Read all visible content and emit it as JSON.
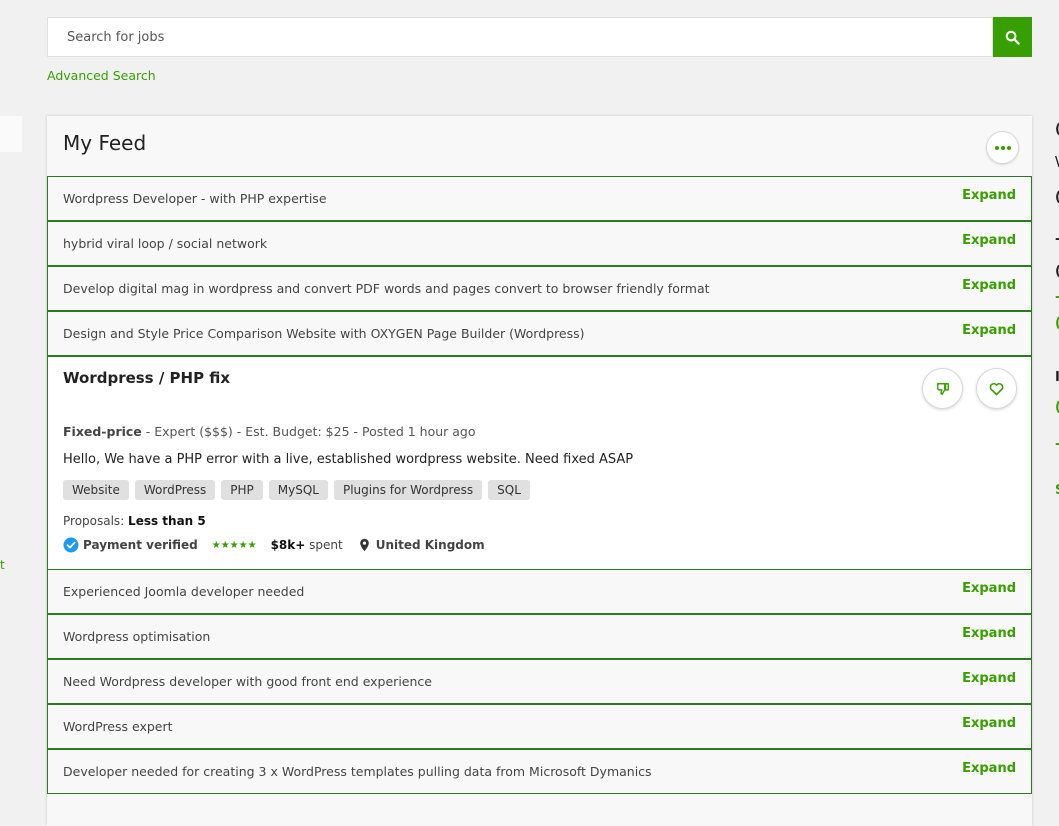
{
  "search": {
    "placeholder": "Search for jobs",
    "advanced_label": "Advanced Search"
  },
  "left_edge_text": "t",
  "right_edge_chars": [
    "(",
    "\\",
    "(",
    "-",
    "(",
    "-",
    "(",
    "I",
    "(",
    "-",
    "S"
  ],
  "feed": {
    "title": "My Feed",
    "expand_label": "Expand",
    "collapsed_before": [
      {
        "title": "Wordpress Developer - with PHP expertise"
      },
      {
        "title": "hybrid viral loop / social network"
      },
      {
        "title": "Develop digital mag in wordpress and convert PDF words and pages convert to browser friendly format"
      },
      {
        "title": "Design and Style Price Comparison Website with OXYGEN Page Builder (Wordpress)"
      }
    ],
    "expanded_job": {
      "title": "Wordpress / PHP fix",
      "type": "Fixed-price",
      "meta_rest": " - Expert ($$$) - Est. Budget: $25 - Posted 1 hour ago",
      "description": "Hello, We have a PHP error with a live, established wordpress website. Need fixed ASAP",
      "skills": [
        "Website",
        "WordPress",
        "PHP",
        "MySQL",
        "Plugins for Wordpress",
        "SQL"
      ],
      "proposals_label": "Proposals: ",
      "proposals_value": "Less than 5",
      "payment": "Payment verified",
      "stars": "★★★★★",
      "spent_amount": "$8k+",
      "spent_label": " spent",
      "location": "United Kingdom"
    },
    "collapsed_after": [
      {
        "title": "Experienced Joomla developer needed"
      },
      {
        "title": "Wordpress optimisation"
      },
      {
        "title": "Need Wordpress developer with good front end experience"
      },
      {
        "title": "WordPress expert"
      },
      {
        "title": "Developer needed for creating 3 x WordPress templates pulling data from Microsoft Dymanics"
      }
    ]
  },
  "colors": {
    "accent": "#37a000",
    "row_border": "#2c7a1f",
    "verified": "#1d9bf0"
  }
}
